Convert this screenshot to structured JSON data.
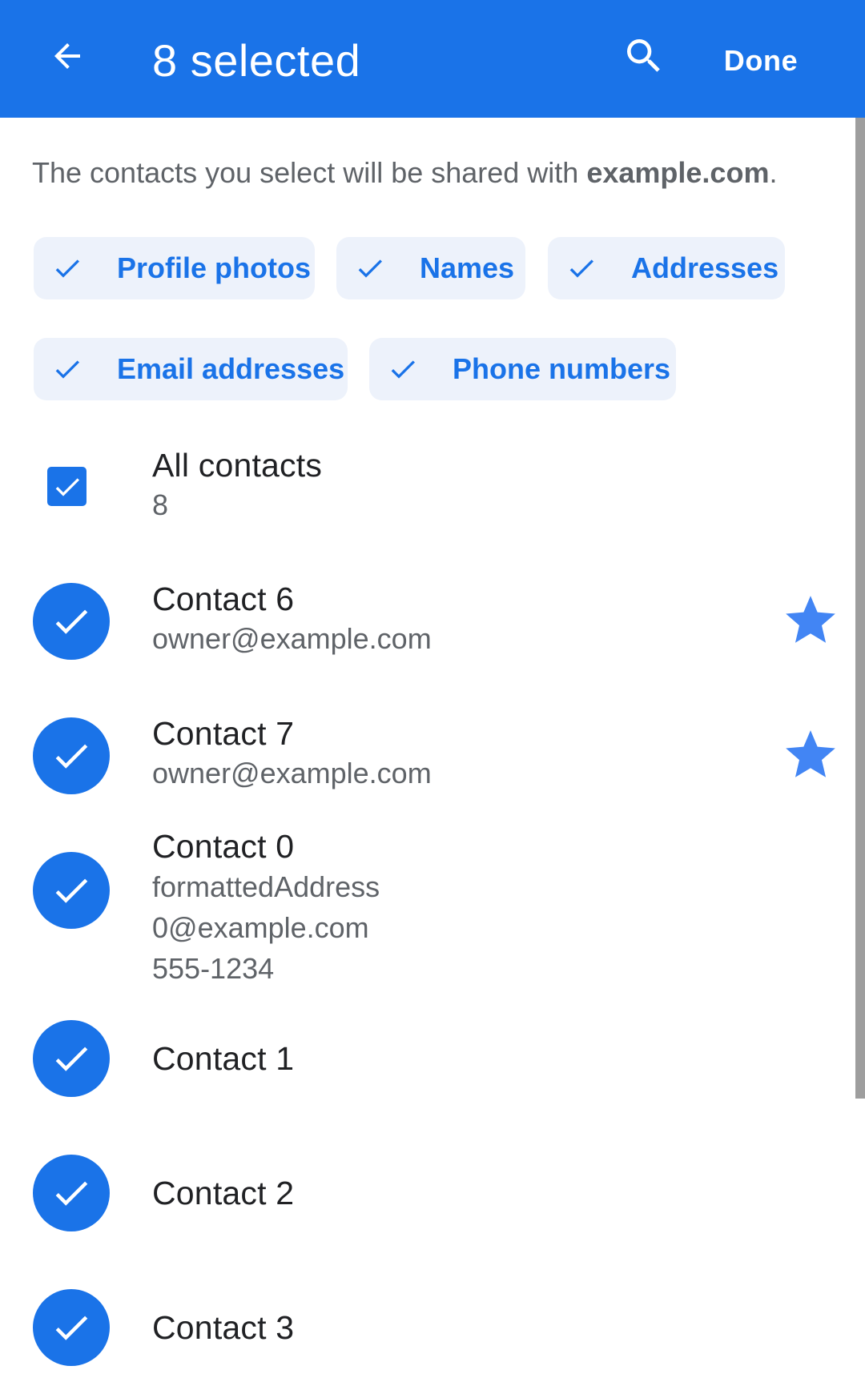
{
  "appbar": {
    "back_icon": "arrow-back-icon",
    "title": "8 selected",
    "search_icon": "search-icon",
    "done_label": "Done"
  },
  "description": {
    "prefix": "The contacts you select will be shared with ",
    "domain": "example.com",
    "suffix": "."
  },
  "chips": [
    {
      "label": "Profile photos",
      "icon": "check-icon"
    },
    {
      "label": "Names",
      "icon": "check-icon"
    },
    {
      "label": "Addresses",
      "icon": "check-icon"
    },
    {
      "label": "Email addresses",
      "icon": "check-icon"
    },
    {
      "label": "Phone numbers",
      "icon": "check-icon"
    }
  ],
  "all_contacts": {
    "label": "All contacts",
    "count": "8",
    "checked": true
  },
  "contacts": [
    {
      "name": "Contact 6",
      "lines": [
        "owner@example.com"
      ],
      "starred": true,
      "selected": true
    },
    {
      "name": "Contact 7",
      "lines": [
        "owner@example.com"
      ],
      "starred": true,
      "selected": true
    },
    {
      "name": "Contact 0",
      "lines": [
        "formattedAddress",
        "0@example.com",
        "555-1234"
      ],
      "starred": false,
      "selected": true
    },
    {
      "name": "Contact 1",
      "lines": [],
      "starred": false,
      "selected": true
    },
    {
      "name": "Contact 2",
      "lines": [],
      "starred": false,
      "selected": true
    },
    {
      "name": "Contact 3",
      "lines": [],
      "starred": false,
      "selected": true
    }
  ],
  "colors": {
    "primary": "#1a73e8",
    "chip_background": "#edf2fb",
    "star": "#4285f4",
    "text_primary": "#202124",
    "text_secondary": "#5f6368"
  }
}
